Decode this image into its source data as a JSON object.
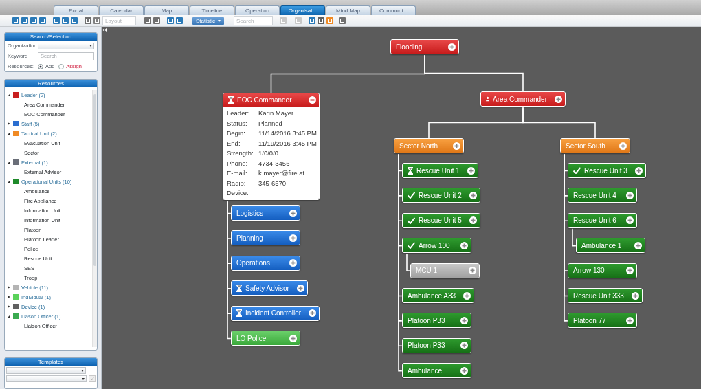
{
  "tabs": [
    {
      "label": "Portal",
      "selected": false
    },
    {
      "label": "Calendar",
      "selected": false
    },
    {
      "label": "Map",
      "selected": false
    },
    {
      "label": "Timeline",
      "selected": false
    },
    {
      "label": "Operation",
      "selected": false
    },
    {
      "label": "Organisat...",
      "selected": true
    },
    {
      "label": "Mind Map",
      "selected": false
    },
    {
      "label": "Communi...",
      "selected": false
    }
  ],
  "toolbar": {
    "layout_placeholder": "Layout",
    "statistic_button": "Statistic",
    "search_placeholder": "Search"
  },
  "search_panel": {
    "title": "Search/Selection",
    "organization_label": "Organization",
    "keyword_label": "Keyword",
    "keyword_placeholder": "Search",
    "resources_label": "Resources:",
    "options": [
      {
        "label": "Add",
        "selected": true
      },
      {
        "label": "Assign",
        "selected": false
      }
    ]
  },
  "resources_panel": {
    "title": "Resources",
    "groups": [
      {
        "label": "Leader (2)",
        "color": "#c81e1e",
        "expanded": true,
        "children": [
          {
            "label": "Area Commander"
          },
          {
            "label": "EOC Commander"
          }
        ]
      },
      {
        "label": "Staff (5)",
        "color": "#2a6ed0",
        "expanded": false
      },
      {
        "label": "Tactical Unit (2)",
        "color": "#f08a24",
        "expanded": true,
        "children": [
          {
            "label": "Evacuation Unit"
          },
          {
            "label": "Sector"
          }
        ]
      },
      {
        "label": "External (1)",
        "color": "#6a6e78",
        "expanded": true,
        "children": [
          {
            "label": "External Advisor"
          }
        ]
      },
      {
        "label": "Operational Units (10)",
        "color": "#1e8a2a",
        "expanded": true,
        "children": [
          {
            "label": "Ambulance"
          },
          {
            "label": "Fire Appliance"
          },
          {
            "label": "Information Unit"
          },
          {
            "label": "Information Unit"
          },
          {
            "label": "Platoon"
          },
          {
            "label": "Platoon Leader"
          },
          {
            "label": "Police"
          },
          {
            "label": "Rescue Unit"
          },
          {
            "label": "SES"
          },
          {
            "label": "Troop"
          }
        ]
      },
      {
        "label": "Vehicle (11)",
        "color": "#b4b4b4",
        "expanded": false
      },
      {
        "label": "Individual (1)",
        "color": "#5ad25a",
        "expanded": false
      },
      {
        "label": "Device (1)",
        "color": "#606060",
        "expanded": false
      },
      {
        "label": "Liason Officer (1)",
        "color": "#3aaa50",
        "expanded": true,
        "children": [
          {
            "label": "Liaison Officer"
          }
        ]
      }
    ]
  },
  "templates_panel": {
    "title": "Templates",
    "checked": true
  },
  "org_chart": {
    "label": "Flooding",
    "kind": "leader",
    "planned": false,
    "confirmed": false,
    "person": false,
    "expanded": false,
    "children": [
      {
        "label": "EOC Commander",
        "kind": "leader",
        "planned": true,
        "confirmed": false,
        "person": false,
        "expanded": true,
        "details": [
          {
            "label": "Leader:",
            "value": "Karin Mayer"
          },
          {
            "label": "Status:",
            "value": "Planned"
          },
          {
            "label": "Begin:",
            "value": "11/14/2016 3:45 PM"
          },
          {
            "label": "End:",
            "value": "11/19/2016 3:45 PM"
          },
          {
            "label": "Strength:",
            "value": "1/0/0/0"
          },
          {
            "label": "Phone:",
            "value": "4734-3456"
          },
          {
            "label": "E-mail:",
            "value": "k.mayer@fire.at"
          },
          {
            "label": "Radio:",
            "value": "345-6570"
          },
          {
            "label": "Device:"
          }
        ],
        "children": [
          {
            "label": "Logistics",
            "kind": "staff",
            "planned": false,
            "confirmed": false,
            "person": false,
            "expanded": false
          },
          {
            "label": "Planning",
            "kind": "staff",
            "planned": false,
            "confirmed": false,
            "person": false,
            "expanded": false
          },
          {
            "label": "Operations",
            "kind": "staff",
            "planned": false,
            "confirmed": false,
            "person": false,
            "expanded": false
          },
          {
            "label": "Safety Advisor",
            "kind": "staff",
            "planned": true,
            "confirmed": false,
            "person": false,
            "expanded": false
          },
          {
            "label": "Incident Controller",
            "kind": "staff",
            "planned": true,
            "confirmed": false,
            "person": false,
            "expanded": false
          },
          {
            "label": "LO Police",
            "kind": "liaison",
            "planned": false,
            "confirmed": false,
            "person": false,
            "expanded": false
          }
        ]
      },
      {
        "label": "Area Commander",
        "kind": "leader",
        "planned": false,
        "confirmed": false,
        "person": true,
        "expanded": false,
        "children": [
          {
            "label": "Sector North",
            "kind": "sector",
            "planned": false,
            "confirmed": false,
            "person": false,
            "expanded": false,
            "children": [
              {
                "label": "Rescue Unit 1",
                "kind": "unit",
                "planned": true,
                "confirmed": false,
                "person": false,
                "expanded": false
              },
              {
                "label": "Rescue Unit 2",
                "kind": "unit",
                "planned": false,
                "confirmed": true,
                "person": false,
                "expanded": false
              },
              {
                "label": "Rescue Unit 5",
                "kind": "unit",
                "planned": false,
                "confirmed": true,
                "person": false,
                "expanded": false
              },
              {
                "label": "Arrow 100",
                "kind": "unit",
                "planned": false,
                "confirmed": true,
                "person": false,
                "expanded": false,
                "children": [
                  {
                    "label": "MCU 1",
                    "kind": "vehicle",
                    "planned": false,
                    "confirmed": false,
                    "person": false,
                    "expanded": false
                  }
                ]
              },
              {
                "label": "Ambulance A33",
                "kind": "unit",
                "planned": false,
                "confirmed": false,
                "person": false,
                "expanded": false
              },
              {
                "label": "Platoon P33",
                "kind": "unit",
                "planned": false,
                "confirmed": false,
                "person": false,
                "expanded": false
              },
              {
                "label": "Platoon P33",
                "kind": "unit",
                "planned": false,
                "confirmed": false,
                "person": false,
                "expanded": false
              },
              {
                "label": "Ambulance",
                "kind": "unit",
                "planned": false,
                "confirmed": false,
                "person": false,
                "expanded": false
              }
            ]
          },
          {
            "label": "Sector South",
            "kind": "sector",
            "planned": false,
            "confirmed": false,
            "person": false,
            "expanded": false,
            "children": [
              {
                "label": "Rescue Unit 3",
                "kind": "unit",
                "planned": false,
                "confirmed": true,
                "person": false,
                "expanded": false
              },
              {
                "label": "Rescue Unit 4",
                "kind": "unit",
                "planned": false,
                "confirmed": false,
                "person": false,
                "expanded": false
              },
              {
                "label": "Rescue Unit 6",
                "kind": "unit",
                "planned": false,
                "confirmed": false,
                "person": false,
                "expanded": false,
                "children": [
                  {
                    "label": "Ambulance 1",
                    "kind": "unit",
                    "planned": false,
                    "confirmed": false,
                    "person": false,
                    "expanded": false
                  }
                ]
              },
              {
                "label": "Arrow 130",
                "kind": "unit",
                "planned": false,
                "confirmed": false,
                "person": false,
                "expanded": false
              },
              {
                "label": "Rescue Unit 333",
                "kind": "unit",
                "planned": false,
                "confirmed": false,
                "person": false,
                "expanded": false
              },
              {
                "label": "Platoon 77",
                "kind": "unit",
                "planned": false,
                "confirmed": false,
                "person": false,
                "expanded": false
              }
            ]
          }
        ]
      }
    ]
  }
}
